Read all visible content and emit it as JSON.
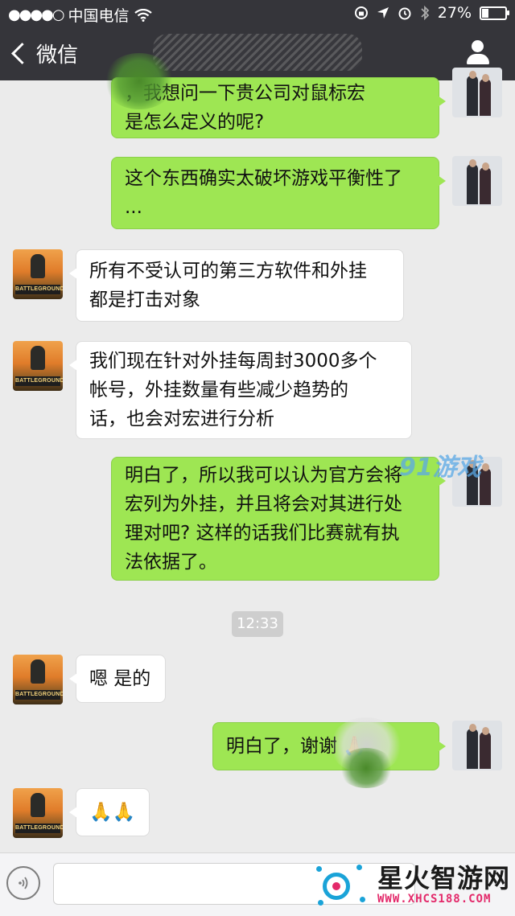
{
  "status_bar": {
    "signal_dots": "●●●●○",
    "carrier": "中国电信",
    "wifi_icon": "wifi-icon",
    "battery_text": "27%",
    "battery_level": 0.27
  },
  "nav": {
    "back_label": "微信"
  },
  "messages": [
    {
      "side": "out",
      "text": "，我想问一下贵公司对鼠标宏\n是怎么定义的呢?"
    },
    {
      "side": "out",
      "text": "这个东西确实太破坏游戏平衡性了\n..."
    },
    {
      "side": "in",
      "text": "所有不受认可的第三方软件和外挂\n都是打击对象"
    },
    {
      "side": "in",
      "text": "我们现在针对外挂每周封3000多个\n帐号，外挂数量有些减少趋势的\n话，也会对宏进行分析"
    },
    {
      "side": "out",
      "text": "明白了，所以我可以认为官方会将\n宏列为外挂，并且将会对其进行处\n理对吧? 这样的话我们比赛就有执\n法依据了。"
    },
    {
      "side": "in",
      "text": "嗯 是的"
    },
    {
      "side": "out",
      "text": "明白了，谢谢 🙏"
    },
    {
      "side": "in",
      "text": "🙏🙏"
    }
  ],
  "timestamp": "12:33",
  "avatar_label": "BATTLEGROUNDS",
  "watermark": {
    "site_name": "星火智游网",
    "site_url": "WWW.XHCS188.COM",
    "corner_mark": "91游戏"
  }
}
